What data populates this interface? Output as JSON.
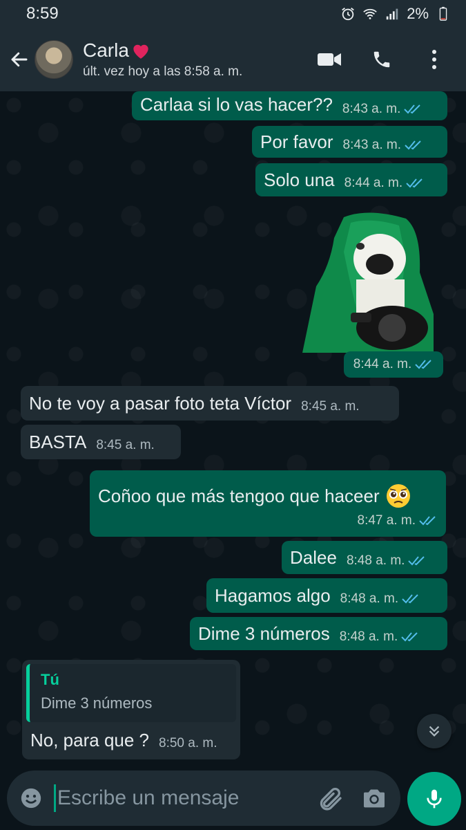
{
  "status_bar": {
    "time": "8:59",
    "battery": "2%"
  },
  "header": {
    "name": "Carla",
    "last_seen": "últ. vez hoy a las 8:58 a. m."
  },
  "messages": [
    {
      "dir": "out",
      "text": "Carlaa si lo vas hacer??",
      "time": "8:43 a. m.",
      "read": true
    },
    {
      "dir": "out",
      "text": "Por favor",
      "time": "8:43 a. m.",
      "read": true
    },
    {
      "dir": "out",
      "text": "Solo una",
      "time": "8:44 a. m.",
      "read": true
    },
    {
      "dir": "out",
      "type": "sticker",
      "time": "8:44 a. m.",
      "read": true
    },
    {
      "dir": "in",
      "text": "No te voy a pasar foto teta Víctor",
      "time": "8:45 a. m."
    },
    {
      "dir": "in",
      "text": "BASTA",
      "time": "8:45 a. m."
    },
    {
      "dir": "out",
      "text": "Coñoo que más tengoo que haceer",
      "emoji": "🥺",
      "time": "8:47 a. m.",
      "read": true
    },
    {
      "dir": "out",
      "text": "Dalee",
      "time": "8:48 a. m.",
      "read": true
    },
    {
      "dir": "out",
      "text": "Hagamos algo",
      "time": "8:48 a. m.",
      "read": true
    },
    {
      "dir": "out",
      "text": "Dime 3 números",
      "time": "8:48 a. m.",
      "read": true
    },
    {
      "dir": "in",
      "quote_author": "Tú",
      "quote_text": "Dime 3 números",
      "text": "No, para que ?",
      "time": "8:50 a. m."
    }
  ],
  "composer": {
    "placeholder": "Escribe un mensaje"
  },
  "colors": {
    "outgoing": "#005c4b",
    "incoming": "#202c33",
    "accent": "#00a884",
    "read_ticks": "#53bdeb"
  }
}
